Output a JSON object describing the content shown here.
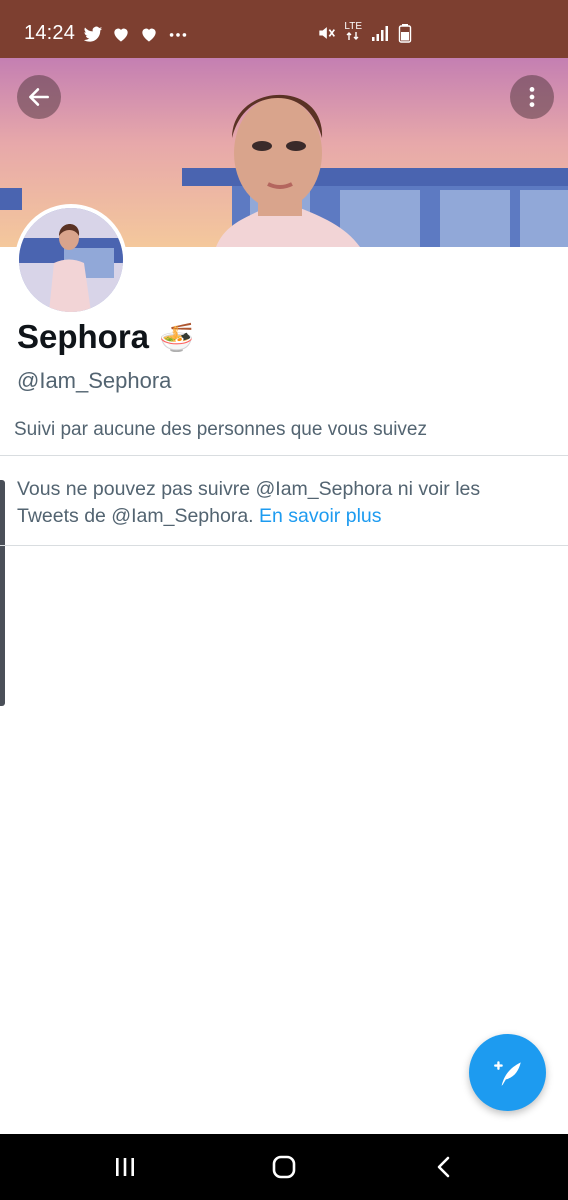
{
  "status_bar": {
    "time": "14:24",
    "icons_left": [
      "twitter-icon",
      "heart-icon",
      "heart-icon",
      "more-horiz-icon"
    ],
    "icons_right": [
      "mute-icon",
      "lte-icon",
      "signal-icon",
      "battery-icon"
    ],
    "lte_label": "LTE",
    "background": "#7d3f30"
  },
  "header": {
    "back_icon": "arrow-left-icon",
    "more_icon": "more-vertical-icon"
  },
  "profile": {
    "display_name": "Sephora",
    "name_emoji": "🍜",
    "handle": "@Iam_Sephora",
    "followed_by": "Suivi par aucune des personnes que vous suivez"
  },
  "notice": {
    "text_part1": "Vous ne pouvez pas suivre @Iam_Sephora ni voir les Tweets de @Iam_Sephora.",
    "link_text": "En savoir plus",
    "link_color": "#1d9bf0"
  },
  "fab": {
    "icon": "compose-tweet-icon",
    "color": "#1d9bf0"
  },
  "nav_bar": {
    "icons": [
      "recents-icon",
      "home-icon",
      "back-icon"
    ]
  }
}
